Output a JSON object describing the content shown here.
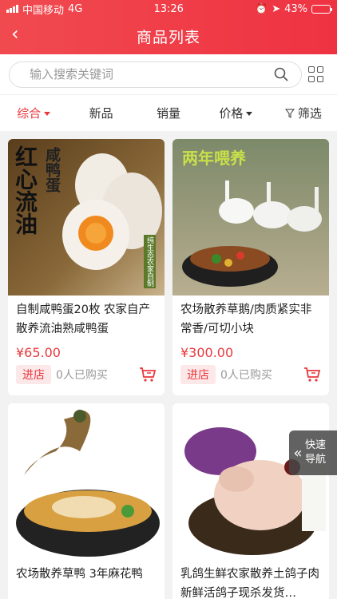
{
  "status": {
    "carrier": "中国移动",
    "network": "4G",
    "time": "13:26",
    "battery": "43%",
    "battery_level": 0.43
  },
  "header": {
    "title": "商品列表"
  },
  "search": {
    "placeholder": "输入搜索关键词"
  },
  "sort": {
    "items": [
      "综合",
      "新品",
      "销量",
      "价格",
      "筛选"
    ]
  },
  "products": [
    {
      "title": "自制咸鸭蛋20枚 农家自产散养流油熟咸鸭蛋",
      "price": "¥65.00",
      "shop": "进店",
      "bought": "0人已购买",
      "img_text": [
        "红心流油",
        "咸鸭蛋",
        "纯生态农家自制"
      ]
    },
    {
      "title": "农场散养草鹅/肉质紧实非常香/可切小块",
      "price": "¥300.00",
      "shop": "进店",
      "bought": "0人已购买",
      "img_text": [
        "两年喂养"
      ]
    },
    {
      "title": "农场散养草鸭 3年麻花鸭",
      "price": "",
      "shop": "",
      "bought": ""
    },
    {
      "title": "乳鸽生鲜农家散养土鸽子肉新鲜活鸽子现杀发货…",
      "price": "",
      "shop": "",
      "bought": ""
    }
  ],
  "float_nav": {
    "label_line1": "快速",
    "label_line2": "导航"
  },
  "colors": {
    "accent": "#e8383d",
    "header": "#ef3242"
  }
}
